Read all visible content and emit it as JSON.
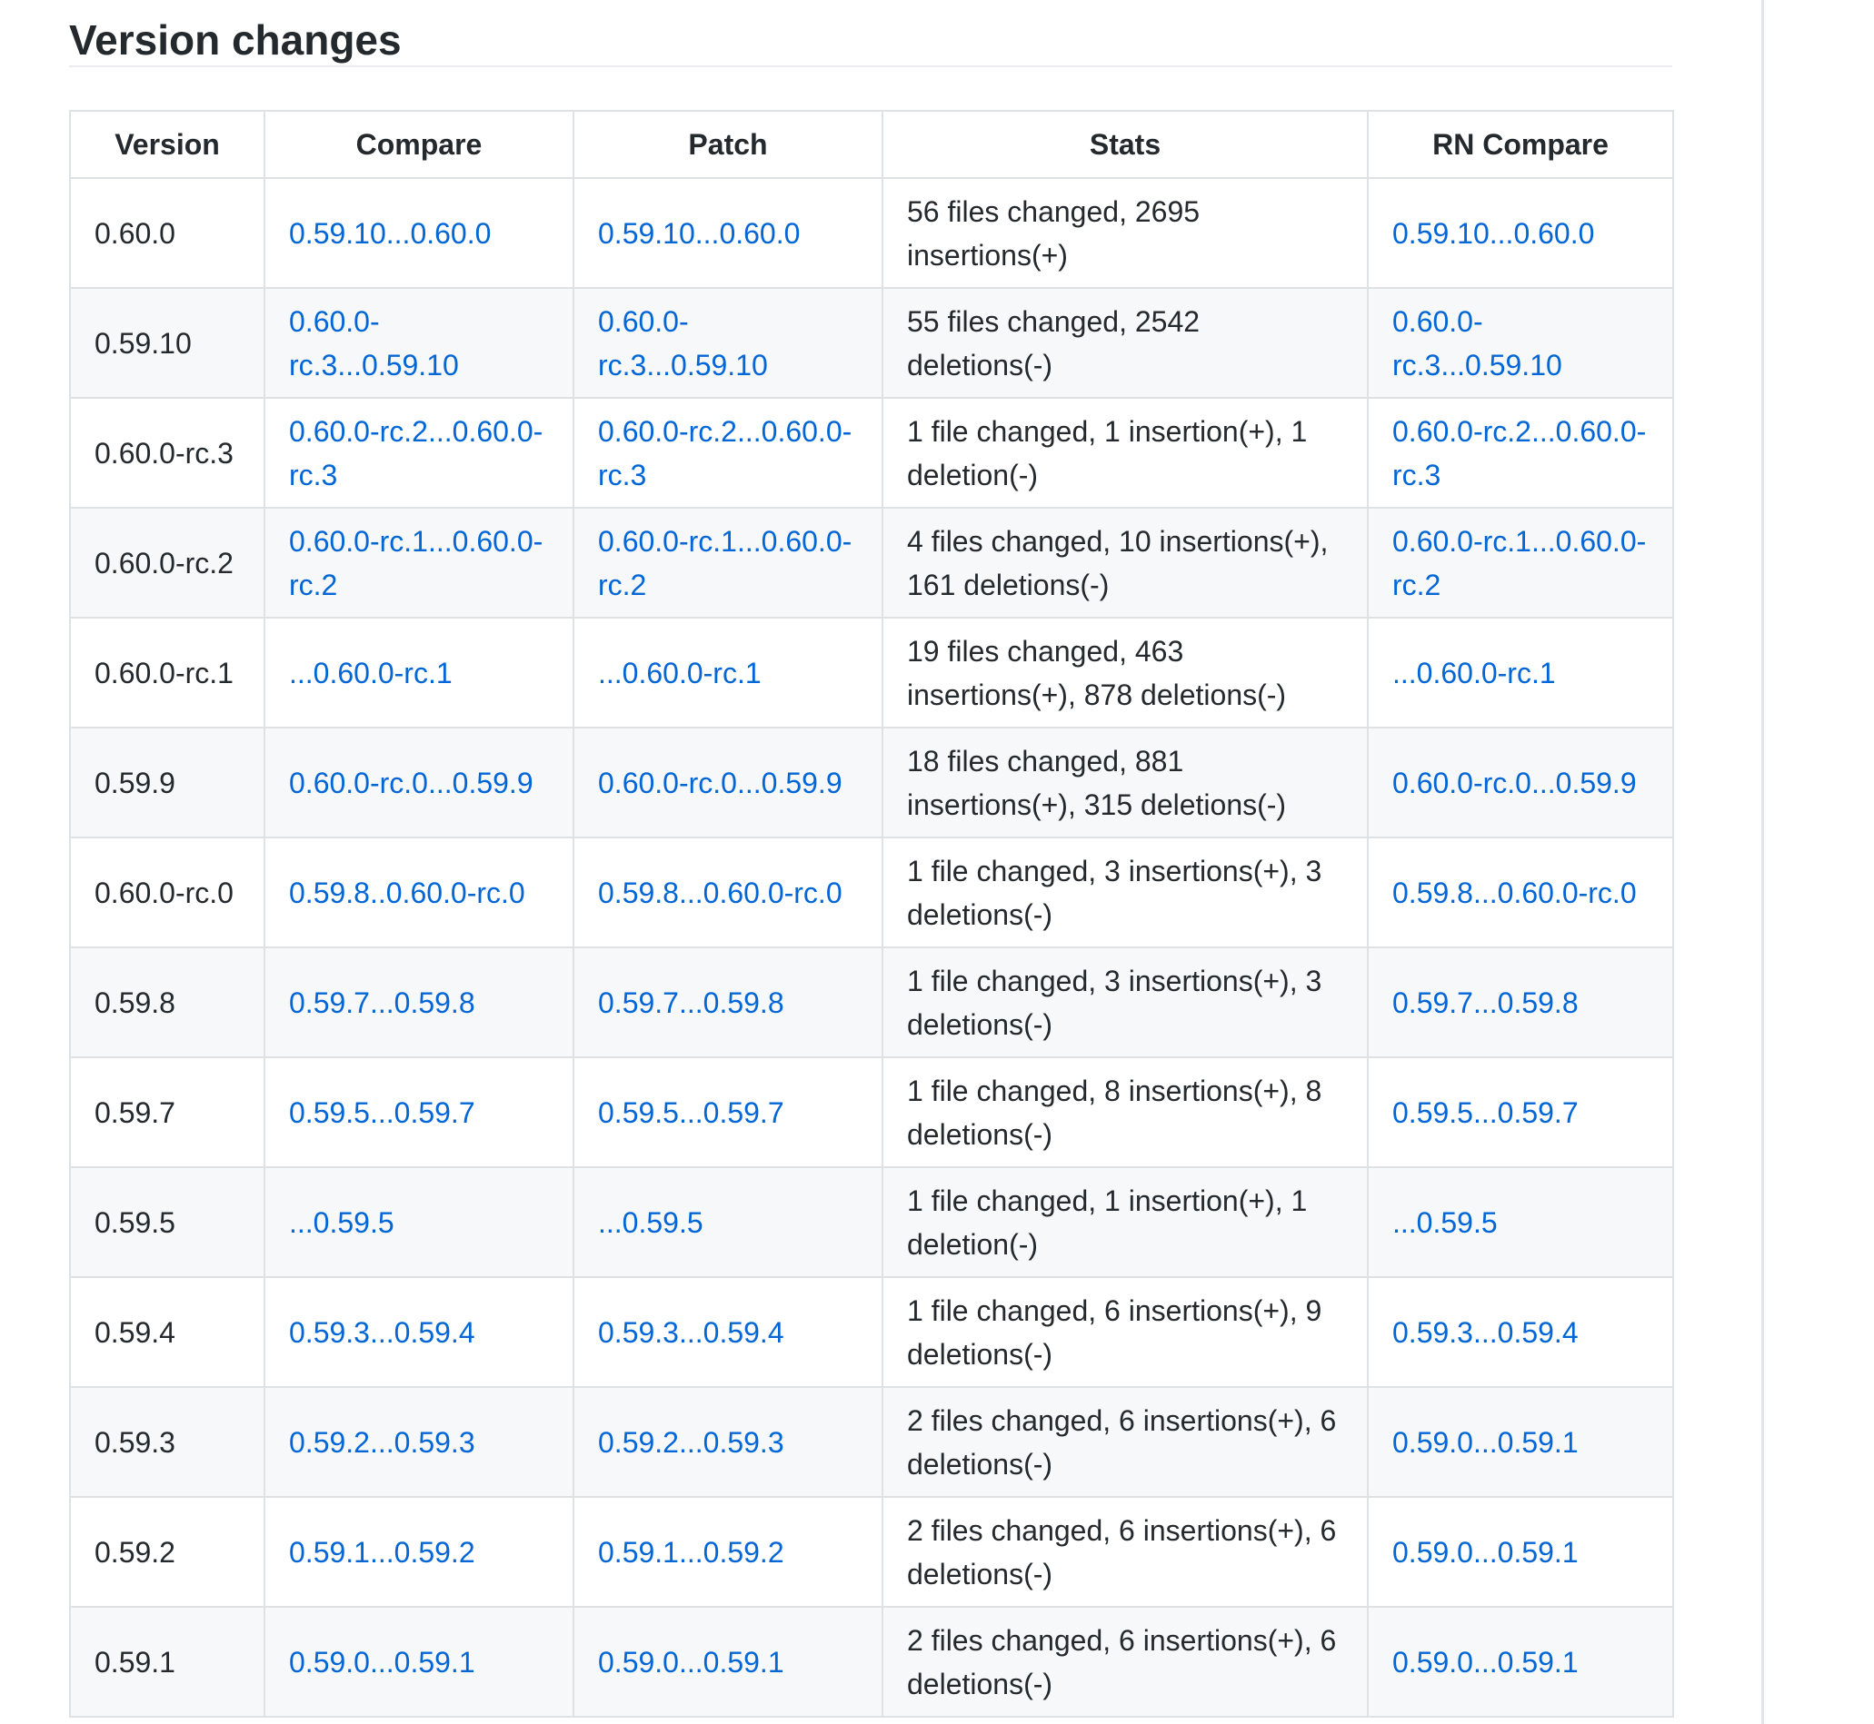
{
  "page": {
    "heading": "Version changes"
  },
  "table": {
    "headers": [
      "Version",
      "Compare",
      "Patch",
      "Stats",
      "RN Compare"
    ],
    "rows": [
      {
        "version": "0.60.0",
        "compare": "0.59.10...0.60.0",
        "patch": "0.59.10...0.60.0",
        "stats": "56 files changed, 2695 insertions(+)",
        "rn_compare": "0.59.10...0.60.0"
      },
      {
        "version": "0.59.10",
        "compare": "0.60.0-rc.3...0.59.10",
        "patch": "0.60.0-rc.3...0.59.10",
        "stats": "55 files changed, 2542 deletions(-)",
        "rn_compare": "0.60.0-rc.3...0.59.10"
      },
      {
        "version": "0.60.0-rc.3",
        "compare": "0.60.0-rc.2...0.60.0-rc.3",
        "patch": "0.60.0-rc.2...0.60.0-rc.3",
        "stats": "1 file changed, 1 insertion(+), 1 deletion(-)",
        "rn_compare": "0.60.0-rc.2...0.60.0-rc.3"
      },
      {
        "version": "0.60.0-rc.2",
        "compare": "0.60.0-rc.1...0.60.0-rc.2",
        "patch": "0.60.0-rc.1...0.60.0-rc.2",
        "stats": "4 files changed, 10 insertions(+), 161 deletions(-)",
        "rn_compare": "0.60.0-rc.1...0.60.0-rc.2"
      },
      {
        "version": "0.60.0-rc.1",
        "compare": "...0.60.0-rc.1",
        "patch": "...0.60.0-rc.1",
        "stats": "19 files changed, 463 insertions(+), 878 deletions(-)",
        "rn_compare": "...0.60.0-rc.1"
      },
      {
        "version": "0.59.9",
        "compare": "0.60.0-rc.0...0.59.9",
        "patch": "0.60.0-rc.0...0.59.9",
        "stats": "18 files changed, 881 insertions(+), 315 deletions(-)",
        "rn_compare": "0.60.0-rc.0...0.59.9"
      },
      {
        "version": "0.60.0-rc.0",
        "compare": "0.59.8..0.60.0-rc.0",
        "patch": "0.59.8...0.60.0-rc.0",
        "stats": "1 file changed, 3 insertions(+), 3 deletions(-)",
        "rn_compare": "0.59.8...0.60.0-rc.0"
      },
      {
        "version": "0.59.8",
        "compare": "0.59.7...0.59.8",
        "patch": "0.59.7...0.59.8",
        "stats": "1 file changed, 3 insertions(+), 3 deletions(-)",
        "rn_compare": "0.59.7...0.59.8"
      },
      {
        "version": "0.59.7",
        "compare": "0.59.5...0.59.7",
        "patch": "0.59.5...0.59.7",
        "stats": "1 file changed, 8 insertions(+), 8 deletions(-)",
        "rn_compare": "0.59.5...0.59.7"
      },
      {
        "version": "0.59.5",
        "compare": "...0.59.5",
        "patch": "...0.59.5",
        "stats": "1 file changed, 1 insertion(+), 1 deletion(-)",
        "rn_compare": "...0.59.5"
      },
      {
        "version": "0.59.4",
        "compare": "0.59.3...0.59.4",
        "patch": "0.59.3...0.59.4",
        "stats": "1 file changed, 6 insertions(+), 9 deletions(-)",
        "rn_compare": "0.59.3...0.59.4"
      },
      {
        "version": "0.59.3",
        "compare": "0.59.2...0.59.3",
        "patch": "0.59.2...0.59.3",
        "stats": "2 files changed, 6 insertions(+), 6 deletions(-)",
        "rn_compare": "0.59.0...0.59.1"
      },
      {
        "version": "0.59.2",
        "compare": "0.59.1...0.59.2",
        "patch": "0.59.1...0.59.2",
        "stats": "2 files changed, 6 insertions(+), 6 deletions(-)",
        "rn_compare": "0.59.0...0.59.1"
      },
      {
        "version": "0.59.1",
        "compare": "0.59.0...0.59.1",
        "patch": "0.59.0...0.59.1",
        "stats": "2 files changed, 6 insertions(+), 6 deletions(-)",
        "rn_compare": "0.59.0...0.59.1"
      }
    ]
  },
  "colors": {
    "link": "#0366d6",
    "text": "#24292e",
    "border": "#dfe2e5",
    "stripe": "#f6f8fa"
  }
}
